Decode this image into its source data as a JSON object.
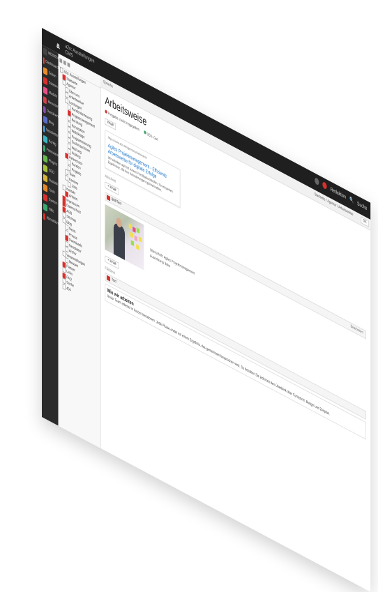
{
  "topbar": {
    "logo": "a",
    "site_line1": "a2o: Ausstellungen",
    "site_line2": "CMS",
    "user": "Redaktion",
    "search": "Suche"
  },
  "nav": {
    "items": [
      {
        "label": "MEDIEN",
        "color": "#444444"
      },
      {
        "label": "Dashboard",
        "color": "#e84b3c"
      },
      {
        "label": "Seiten",
        "color": "#e98c2c"
      },
      {
        "label": "Dateien",
        "color": "#d9302c"
      },
      {
        "label": "Module",
        "color": "#e94f87"
      },
      {
        "label": "Benutzer",
        "color": "#d4424a"
      },
      {
        "label": "Domänen",
        "color": "#8a4fb0"
      },
      {
        "label": "Blog",
        "color": "#5a6cc9"
      },
      {
        "label": "Newsletter",
        "color": "#4f9fe0"
      },
      {
        "label": "Konfig",
        "color": "#3bb3c1"
      },
      {
        "label": "Formulare",
        "color": "#3aa76d"
      },
      {
        "label": "Plugins",
        "color": "#66b94a"
      },
      {
        "label": "SEO",
        "color": "#a6c23a"
      },
      {
        "label": "Statistik",
        "color": "#d5b53a"
      },
      {
        "label": "Tools",
        "color": "#e6882c"
      },
      {
        "label": "System",
        "color": "#d9302c"
      },
      {
        "label": "Hilfe",
        "color": "#3aa76d"
      },
      {
        "label": "Abmelden",
        "color": "#d9302c"
      }
    ]
  },
  "tree": {
    "rows": [
      "a2o: Ausstellungen",
      "Startseite",
      "Agentur",
      "Über uns",
      "Arbeitsweise",
      "Leistungen",
      "Kundenbetreuung",
      "Projektmanagement",
      "Beratung",
      "Konzeption",
      "Webdesign",
      "Programmierung",
      "Suchmaschinen",
      "Wartung",
      "Hosting",
      "Referenzen",
      "Kunden",
      "Projekte",
      "Team",
      "Karriere",
      "Jobs",
      "Kontakt",
      "Anfahrt",
      "Impressum",
      "Datenschutz",
      "AGB",
      "Sitemap",
      "Blog",
      "News",
      "Presse",
      "Downloads",
      "Newsletter",
      "Archiv",
      "Veranstaltungen",
      "Messen",
      "Partner",
      "Links",
      "FAQ",
      "Suche",
      "404"
    ]
  },
  "subbar": {
    "label": "Sprache",
    "crumb": "Startseite / Agentur / Arbeitsweise",
    "tag": "DE"
  },
  "main": {
    "title": "Arbeitsweise",
    "status_left": "Freigabe: nicht freigegeben",
    "status_right": "SEO: Gut",
    "badge": "Inhalt",
    "card": {
      "url": "https://www.a2o.de/agentur/arbeitsweise",
      "title": "Agiles Projektmanagement - Effiziente Arbeitsweise für digitale Erfolge",
      "desc": "Wir arbeiten agil mit kurzen Feedbackschleifen. So entstehen Ergebnisse, die Ihre Anforderungen optimal treffen."
    },
    "section1": "Abschnitt",
    "add1": "+ Inhalt",
    "slice1_label": "Bild/Text",
    "slice1_right": "Bearbeiten",
    "image_caption": "Überschrift: Agiles Projektmanagement",
    "image_meta": "Ausrichtung: links",
    "add2": "+ Inhalt",
    "section2": "Fließtext",
    "slice2_label": "Text",
    "text_head": "Wie wir arbeiten",
    "text_body": "Unser Team arbeitet in kurzen Iterationen. Jede Phase endet mit einem Ergebnis, das gemeinsam besprochen wird. So behalten Sie jederzeit den Überblick über Fortschritt, Budget und Zeitplan."
  }
}
